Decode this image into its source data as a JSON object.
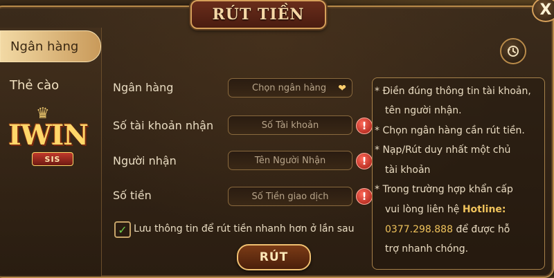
{
  "dialog": {
    "title": "RÚT TIỀN",
    "close_label": "X"
  },
  "sidebar": {
    "tabs": [
      {
        "label": "Ngân hàng",
        "active": true
      },
      {
        "label": "Thẻ cào",
        "active": false
      }
    ],
    "logo": {
      "word": "IWIN",
      "badge": "SIS"
    }
  },
  "form": {
    "bank": {
      "label": "Ngân hàng",
      "placeholder": "Chọn ngân hàng"
    },
    "account": {
      "label": "Số tài khoản nhận",
      "placeholder": "Số Tài khoản"
    },
    "recipient": {
      "label": "Người nhận",
      "placeholder": "Tên Người Nhận"
    },
    "amount": {
      "label": "Số tiền",
      "placeholder": "Số Tiền giao dịch"
    },
    "save_info": {
      "label": "Lưu thông tin để rút tiền nhanh hơn ở lần sau",
      "checked": true
    },
    "submit_label": "RÚT"
  },
  "notes": {
    "lines": [
      "* Điền đúng thông tin tài khoản,",
      "tên người nhận.",
      "* Chọn ngân hàng cần rút tiền.",
      "* Nạp/Rút duy nhất một chủ",
      "tài khoản",
      "* Trong trường hợp khẩn cấp",
      "vui lòng liên hệ",
      "Hotline:",
      "0377.298.888",
      "để được hỗ",
      "trợ nhanh chóng."
    ]
  },
  "colors": {
    "accent_gold": "#d6a05a",
    "hotline": "#f0c35c",
    "warning_red": "#d0281a",
    "check_green": "#6ed04a"
  },
  "icons": {
    "history": "history-icon",
    "warning": "warning-icon",
    "close": "close-icon",
    "dropdown": "heart-icon",
    "check": "checkmark-icon"
  }
}
